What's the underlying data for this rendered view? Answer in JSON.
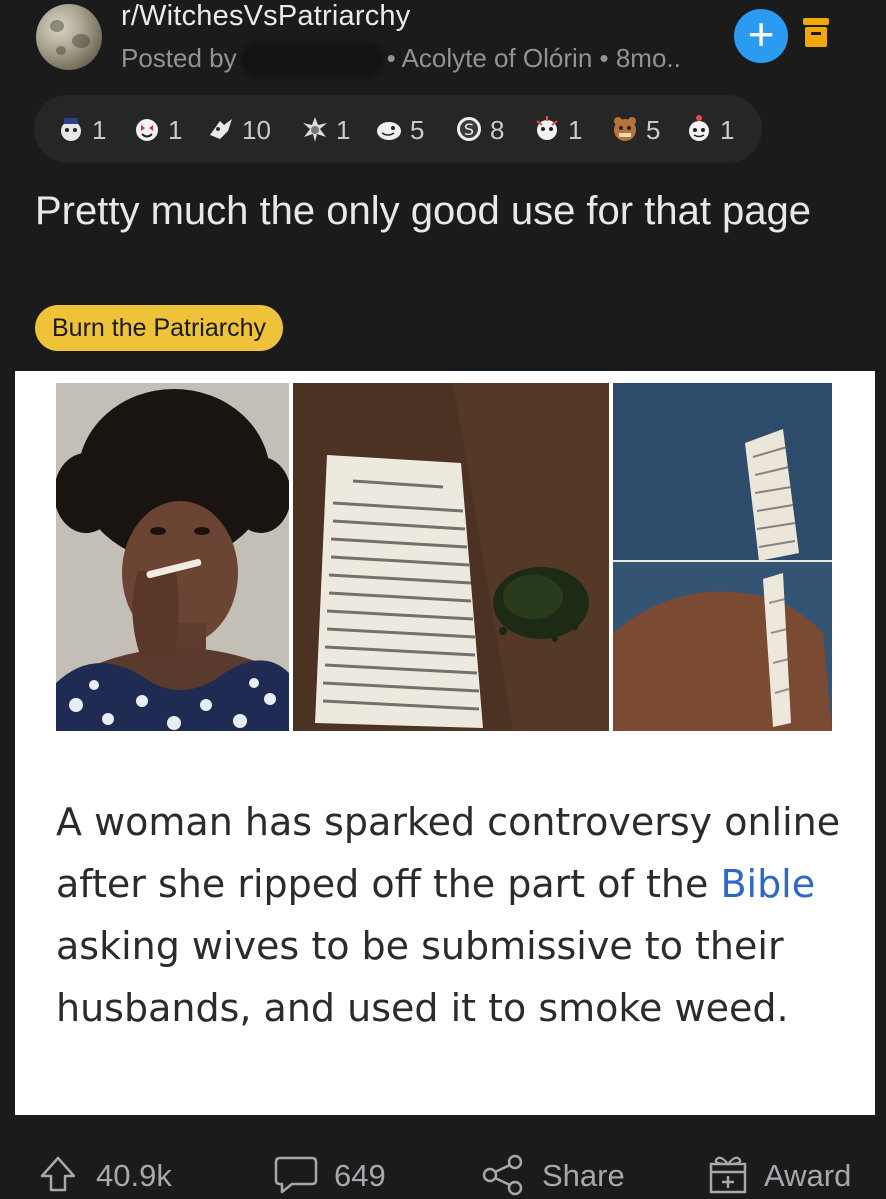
{
  "header": {
    "subreddit": "r/WitchesVsPatriarchy",
    "posted_by_prefix": "Posted by",
    "user_flair_and_age": "• Acolyte of Olórin • 8mo..",
    "join_label": "+"
  },
  "awards": [
    {
      "icon": "award-icon",
      "count": "1"
    },
    {
      "icon": "award-icon",
      "count": "1"
    },
    {
      "icon": "award-icon",
      "count": "10"
    },
    {
      "icon": "award-icon",
      "count": "1"
    },
    {
      "icon": "award-icon",
      "count": "5"
    },
    {
      "icon": "award-icon",
      "count": "8"
    },
    {
      "icon": "award-icon",
      "count": "1"
    },
    {
      "icon": "award-icon",
      "count": "5"
    },
    {
      "icon": "award-icon",
      "count": "1"
    }
  ],
  "post": {
    "title": "Pretty much the only good use for that page",
    "flair": "Burn the Patriarchy",
    "caption_before": "A woman has sparked controversy online after she ripped off the part of the ",
    "caption_link": "Bible",
    "caption_after": " asking wives to be submissive to their husbands, and used it to smoke weed."
  },
  "actions": {
    "upvotes": "40.9k",
    "comments": "649",
    "share": "Share",
    "award": "Award"
  },
  "colors": {
    "background": "#1b1b1c",
    "accent_blue": "#2a9bf1",
    "flair_yellow": "#eec239",
    "archive_orange": "#f1a90a",
    "link_blue": "#2f66c9"
  }
}
